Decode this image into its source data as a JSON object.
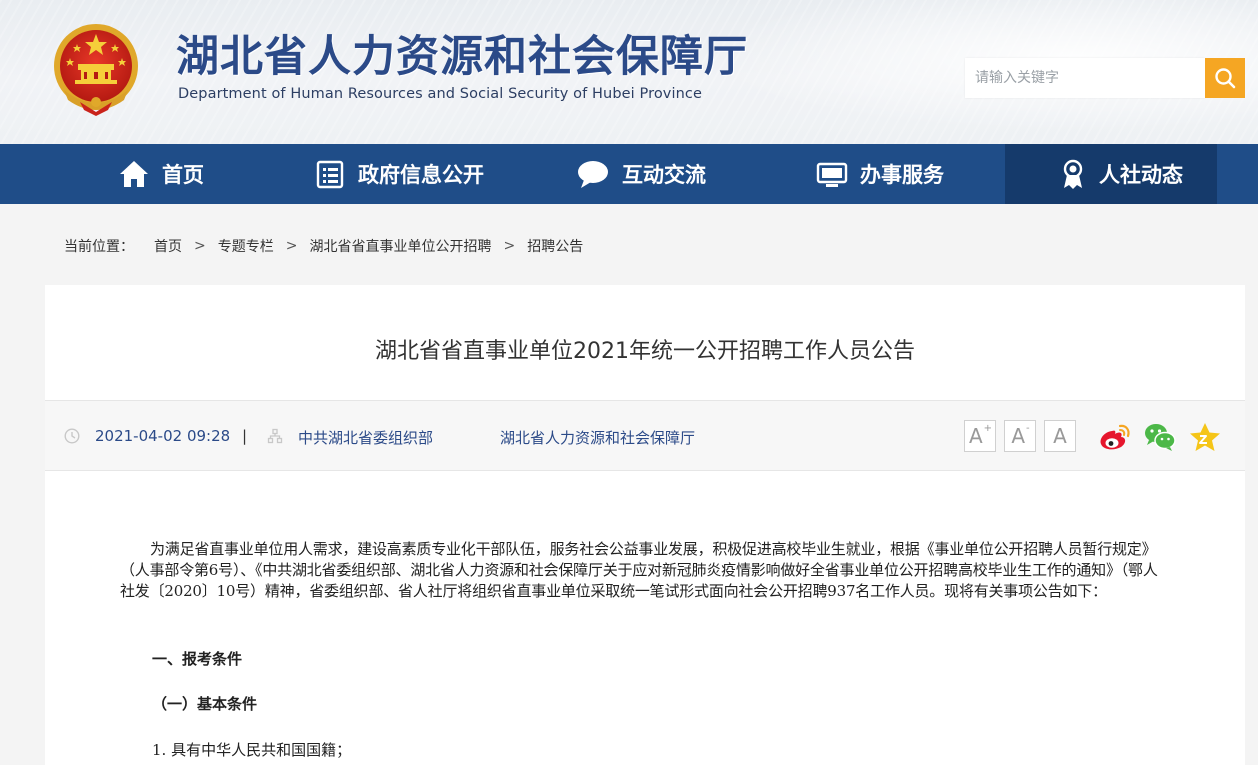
{
  "header": {
    "title": "湖北省人力资源和社会保障厅",
    "subtitle": "Department of Human Resources and Social Security of Hubei Province",
    "search_placeholder": "请输入关键字"
  },
  "nav": {
    "items": [
      {
        "label": "首页",
        "icon": "home-icon"
      },
      {
        "label": "政府信息公开",
        "icon": "document-list-icon"
      },
      {
        "label": "互动交流",
        "icon": "chat-bubble-icon"
      },
      {
        "label": "办事服务",
        "icon": "monitor-icon"
      },
      {
        "label": "人社动态",
        "icon": "person-badge-icon",
        "active": true
      }
    ]
  },
  "breadcrumb": {
    "label": "当前位置：",
    "items": [
      "首页",
      "专题专栏",
      "湖北省省直事业单位公开招聘",
      "招聘公告"
    ],
    "separator": ">"
  },
  "article": {
    "title": "湖北省省直事业单位2021年统一公开招聘工作人员公告",
    "meta": {
      "datetime": "2021-04-02 09:28",
      "pipe": "|",
      "source1": "中共湖北省委组织部",
      "source2": "湖北省人力资源和社会保障厅"
    },
    "font_buttons": [
      "A",
      "A",
      "A"
    ],
    "font_buttons_sup": [
      "+",
      "-",
      ""
    ],
    "share_icons": [
      "weibo-icon",
      "wechat-icon",
      "favorite-star-icon"
    ],
    "paragraph1": "为满足省直事业单位用人需求，建设高素质专业化干部队伍，服务社会公益事业发展，积极促进高校毕业生就业，根据《事业单位公开招聘人员暂行规定》（人事部令第6号）、《中共湖北省委组织部、湖北省人力资源和社会保障厅关于应对新冠肺炎疫情影响做好全省事业单位公开招聘高校毕业生工作的通知》（鄂人社发〔2020〕10号）精神，省委组织部、省人社厅将组织省直事业单位采取统一笔试形式面向社会公开招聘937名工作人员。现将有关事项公告如下：",
    "section1": "一、报考条件",
    "subsection1": "（一）基本条件",
    "item1": "1. 具有中华人民共和国国籍；"
  },
  "colors": {
    "nav_bg": "#1f4d88",
    "nav_active": "#153a6b",
    "search_button": "#f5a623",
    "title_blue": "#2b4a88"
  }
}
